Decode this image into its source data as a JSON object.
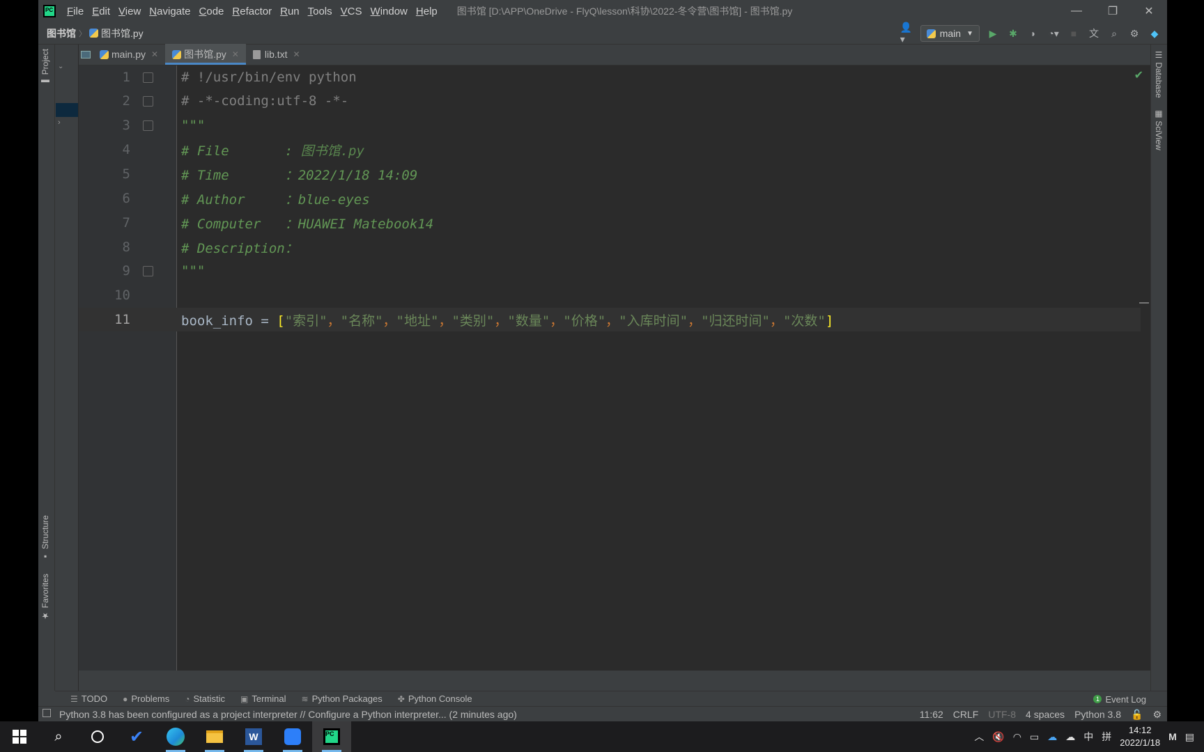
{
  "window": {
    "title": "图书馆 [D:\\APP\\OneDrive - FlyQ\\lesson\\科协\\2022-冬令营\\图书馆] - 图书馆.py",
    "menu": [
      "File",
      "Edit",
      "View",
      "Navigate",
      "Code",
      "Refactor",
      "Run",
      "Tools",
      "VCS",
      "Window",
      "Help"
    ]
  },
  "navbar": {
    "project": "图书馆",
    "file": "图书馆.py",
    "run_config": "main"
  },
  "left_tabs": {
    "project": "Project",
    "structure": "Structure",
    "favorites": "Favorites"
  },
  "right_tabs": {
    "database": "Database",
    "sciview": "SciView"
  },
  "tabs": [
    {
      "label": "main.py",
      "icon": "python-file-icon",
      "active": false
    },
    {
      "label": "图书馆.py",
      "icon": "python-file-icon",
      "active": true
    },
    {
      "label": "lib.txt",
      "icon": "text-file-icon",
      "active": false
    }
  ],
  "editor": {
    "line_numbers": [
      "1",
      "2",
      "3",
      "4",
      "5",
      "6",
      "7",
      "8",
      "9",
      "10",
      "11"
    ],
    "lines": {
      "l1": "# !/usr/bin/env python",
      "l2": "# -*-coding:utf-8 -*-",
      "l3": "\"\"\"",
      "l4_key": "# File       : ",
      "l4_val": "图书馆.py",
      "l5": "# Time       ：2022/1/18 14:09",
      "l6": "# Author     ：blue-eyes",
      "l7": "# Computer   ：HUAWEI Matebook14",
      "l8": "# Description：",
      "l9": "\"\"\"",
      "l11_ident": "book_info = ",
      "l11_items": [
        "\"索引\"",
        "\"名称\"",
        "\"地址\"",
        "\"类别\"",
        "\"数量\"",
        "\"价格\"",
        "\"入库时间\"",
        "\"归还时间\"",
        "\"次数\""
      ],
      "l11_sep": "，",
      "l11_open": "[",
      "l11_close": "]"
    }
  },
  "bottom_tools": [
    "TODO",
    "Problems",
    "Statistic",
    "Terminal",
    "Python Packages",
    "Python Console"
  ],
  "event_log": "Event Log",
  "event_count": "1",
  "status": {
    "message": "Python 3.8 has been configured as a project interpreter // Configure a Python interpreter... (2 minutes ago)",
    "position": "11:62",
    "line_sep": "CRLF",
    "encoding": "UTF-8",
    "indent": "4 spaces",
    "interpreter": "Python 3.8"
  },
  "taskbar": {
    "ime": "中",
    "ime2": "拼",
    "time": "14:12",
    "date": "2022/1/18"
  },
  "colors": {
    "ide_bg": "#3c3f41",
    "editor_bg": "#2b2b2b",
    "comment": "#808080",
    "docstring": "#629755",
    "string": "#6a8759",
    "accent": "#4a88c7"
  }
}
